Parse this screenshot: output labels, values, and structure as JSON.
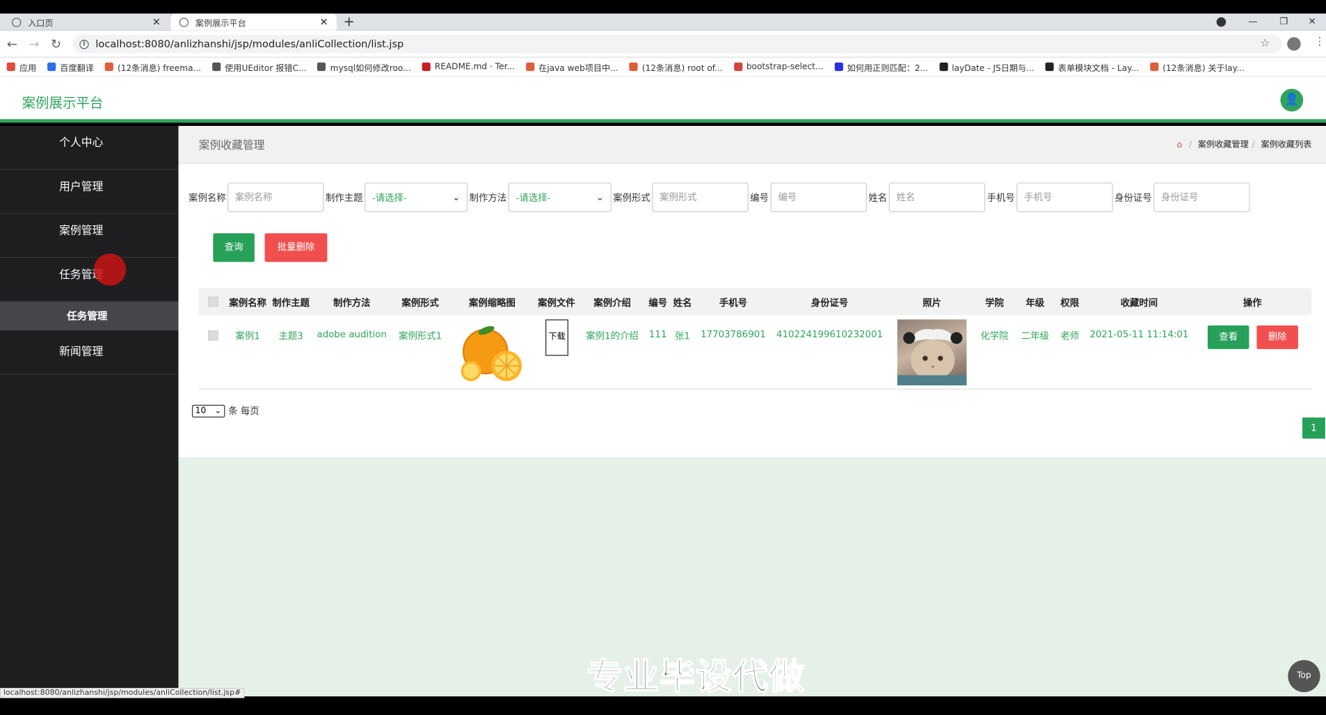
{
  "browser": {
    "tabs": [
      {
        "label": "入口页",
        "active": false
      },
      {
        "label": "案例展示平台",
        "active": true
      }
    ],
    "new_tab": "+",
    "url": "localhost:8080/anlizhanshi/jsp/modules/anliCollection/list.jsp",
    "bookmarks": [
      {
        "label": "应用",
        "icon": "apps-grid-icon",
        "color": "#e04a3f"
      },
      {
        "label": "百度翻译",
        "icon": "translate-icon",
        "color": "#2a6de8"
      },
      {
        "label": "(12条消息) freema...",
        "icon": "csdn-icon",
        "color": "#e05d3a"
      },
      {
        "label": "使用UEditor 报错C...",
        "icon": "link-icon",
        "color": "#555555"
      },
      {
        "label": "mysql如何修改roo...",
        "icon": "link-icon",
        "color": "#555555"
      },
      {
        "label": "README.md · Ter...",
        "icon": "gitee-icon",
        "color": "#c71d23"
      },
      {
        "label": "在java web项目中...",
        "icon": "csdn-icon",
        "color": "#e05d3a"
      },
      {
        "label": "(12条消息) root of...",
        "icon": "csdn-icon",
        "color": "#e05d3a"
      },
      {
        "label": "bootstrap-select...",
        "icon": "bootstrap-icon",
        "color": "#d3453a"
      },
      {
        "label": "如何用正则匹配：2...",
        "icon": "baidu-paw-icon",
        "color": "#2932e1"
      },
      {
        "label": "layDate - JS日期与...",
        "icon": "layui-icon",
        "color": "#222222"
      },
      {
        "label": "表单模块文档 - Lay...",
        "icon": "layui-icon",
        "color": "#222222"
      },
      {
        "label": "(12条消息) 关于lay...",
        "icon": "csdn-icon",
        "color": "#e05d3a"
      }
    ],
    "status_url": "localhost:8080/anlizhanshi/jsp/modules/anliCollection/list.jsp#"
  },
  "app": {
    "brand": "案例展示平台",
    "accent": "#2fa45b"
  },
  "sidebar": {
    "items": [
      {
        "label": "个人中心"
      },
      {
        "label": "用户管理"
      },
      {
        "label": "案例管理"
      },
      {
        "label": "任务管理"
      }
    ],
    "sub_item": "任务管理",
    "last_item": "新闻管理"
  },
  "page": {
    "title": "案例收藏管理",
    "breadcrumb": [
      "案例收藏管理",
      "案例收藏列表"
    ]
  },
  "search": {
    "fields": [
      {
        "label": "案例名称",
        "placeholder": "案例名称"
      },
      {
        "label": "制作主题",
        "select": "-请选择-"
      },
      {
        "label": "制作方法",
        "select": "-请选择-"
      },
      {
        "label": "案例形式",
        "placeholder": "案例形式"
      },
      {
        "label": "编号",
        "placeholder": "编号"
      },
      {
        "label": "姓名",
        "placeholder": "姓名"
      },
      {
        "label": "手机号",
        "placeholder": "手机号"
      },
      {
        "label": "身份证号",
        "placeholder": "身份证号"
      }
    ],
    "query_button": "查询",
    "batch_delete_button": "批量删除"
  },
  "table": {
    "columns": [
      "案例名称",
      "制作主题",
      "制作方法",
      "案例形式",
      "案例缩略图",
      "案例文件",
      "案例介绍",
      "编号",
      "姓名",
      "手机号",
      "身份证号",
      "照片",
      "学院",
      "年级",
      "权限",
      "收藏时间",
      "操作"
    ],
    "rows": [
      {
        "name": "案例1",
        "theme": "主题3",
        "method": "adobe audition",
        "form": "案例形式1",
        "file_link": "下载",
        "intro": "案例1的介绍",
        "number": "111",
        "person": "张1",
        "phone": "17703786901",
        "id_card": "410224199610232001",
        "college": "化学院",
        "grade": "二年级",
        "role": "老师",
        "time": "2021-05-11 11:14:01",
        "view_button": "查看",
        "delete_button": "删除"
      }
    ]
  },
  "pagination": {
    "page_size": "10",
    "per_page_label": "条 每页",
    "current_page": "1"
  },
  "overlay": {
    "watermark": "专业毕设代做",
    "top_button": "Top"
  }
}
